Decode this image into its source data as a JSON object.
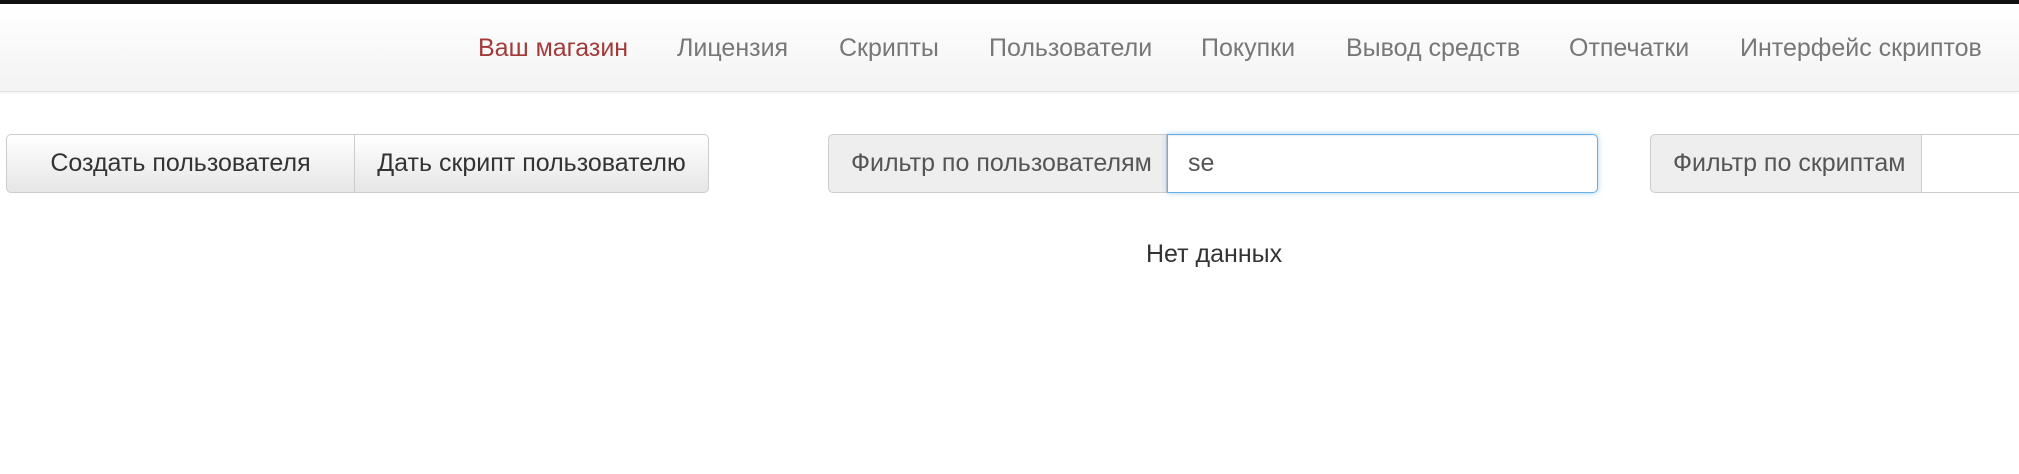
{
  "nav": {
    "items": [
      {
        "label": "Ваш магазин",
        "active": true
      },
      {
        "label": "Лицензия"
      },
      {
        "label": "Скрипты"
      },
      {
        "label": "Пользователи"
      },
      {
        "label": "Покупки"
      },
      {
        "label": "Вывод средств"
      },
      {
        "label": "Отпечатки"
      },
      {
        "label": "Интерфейс скриптов"
      }
    ]
  },
  "actions": {
    "create_user_label": "Создать пользователя",
    "give_script_label": "Дать скрипт пользователю"
  },
  "filters": {
    "users": {
      "label": "Фильтр по пользователям",
      "value": "se"
    },
    "scripts": {
      "label": "Фильтр по скриптам",
      "value": ""
    }
  },
  "results": {
    "empty_text": "Нет данных"
  },
  "colors": {
    "active_nav": "#a33a3a",
    "focus_border": "#66afe9"
  }
}
